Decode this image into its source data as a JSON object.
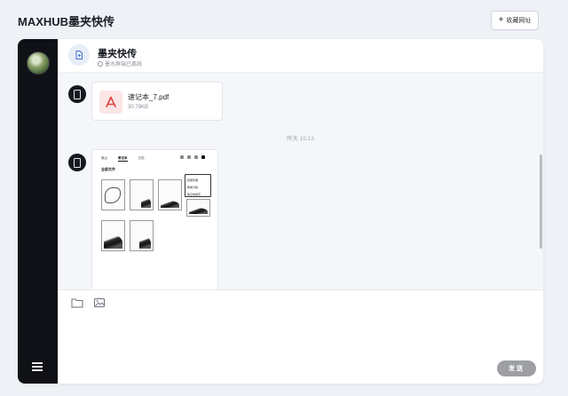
{
  "app": {
    "title": "MAXHUB墨夹快传"
  },
  "topbar": {
    "bookmark_label": "收藏网址",
    "bookmark_icon": "plus-icon"
  },
  "header": {
    "title": "墨夹快传",
    "subtitle": "墨水屏端已离线"
  },
  "messages": {
    "top_timestamp": "",
    "file": {
      "name": "速记本_7.pdf",
      "size": "30.79KB"
    },
    "timestamp": "昨天 15:13",
    "image_preview": {
      "tabs": [
        "最近",
        "笔记本",
        "文档"
      ],
      "heading": "全部文件",
      "menu": [
        "批量管理",
        "按类分组",
        "笔记本排序"
      ],
      "docs": [
        {
          "label": "",
          "caption": ""
        },
        {
          "label": "",
          "caption": ""
        },
        {
          "label": "",
          "caption": ""
        },
        {
          "label": "",
          "caption": ""
        },
        {
          "label": "",
          "caption": ""
        },
        {
          "label": "",
          "caption": ""
        }
      ]
    }
  },
  "composer": {
    "send_label": "发送"
  },
  "colors": {
    "sidebar": "#0f1116",
    "send": "#9d9fa4",
    "chat_bg": "#f4f6f9"
  }
}
